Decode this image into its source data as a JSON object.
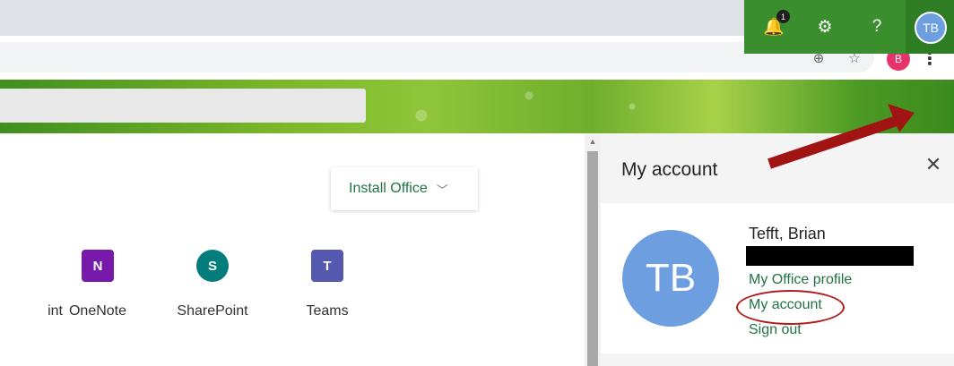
{
  "window": {
    "minimize_icon": "–",
    "maximize_icon": "❐",
    "close_icon": "✕"
  },
  "browser": {
    "install_icon": "⊕",
    "star_icon": "☆",
    "profile_initial": "B",
    "menu_icon": "⋮"
  },
  "header": {
    "notification_count": "1",
    "bell_icon": "🔔",
    "gear_icon": "⚙",
    "help_icon": "?",
    "avatar_initials": "TB"
  },
  "main": {
    "install_office_label": "Install Office",
    "install_chevron": "﹀",
    "apps": [
      {
        "label": "int",
        "icon_text": ""
      },
      {
        "label": "OneNote",
        "icon_text": "N"
      },
      {
        "label": "SharePoint",
        "icon_text": "S"
      },
      {
        "label": "Teams",
        "icon_text": "T"
      }
    ]
  },
  "account_panel": {
    "title": "My account",
    "close_icon": "✕",
    "avatar_initials": "TB",
    "user_name": "Tefft, Brian",
    "links": {
      "profile": "My Office profile",
      "account": "My account",
      "signout": "Sign out"
    }
  },
  "colors": {
    "accent_green": "#217346",
    "avatar_blue": "#6c9ee0",
    "annotation_red": "#b31a1a"
  }
}
